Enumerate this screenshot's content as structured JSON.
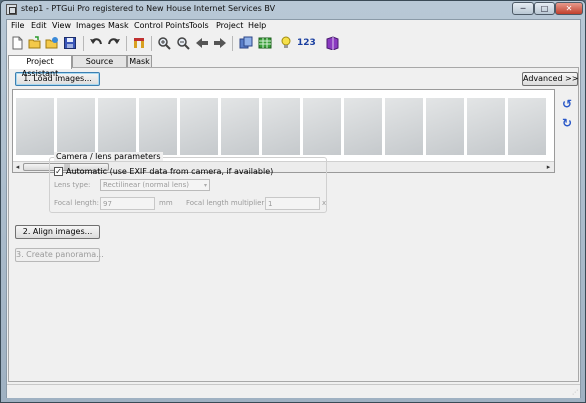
{
  "window": {
    "title": "step1 - PTGui Pro registered to New House Internet Services BV",
    "min_glyph": "─",
    "max_glyph": "□",
    "close_glyph": "✕"
  },
  "menu": [
    "File",
    "Edit",
    "View",
    "Images",
    "Mask",
    "Control Points",
    "Tools",
    "Project",
    "Help"
  ],
  "toolbar": {
    "icons": [
      "new-file-icon",
      "open-folder-icon",
      "open-recent-icon",
      "save-icon",
      "undo-icon",
      "redo-icon",
      "control-point-editor-icon",
      "zoom-in-icon",
      "zoom-out-icon",
      "back-arrow-icon",
      "forward-arrow-icon",
      "panorama-editor-icon",
      "table-icon",
      "lightbulb-icon",
      "optimizer-icon",
      "batch-book-icon"
    ],
    "number_label": "123"
  },
  "tabs": [
    "Project Assistant",
    "Source Images",
    "Mask"
  ],
  "main": {
    "load_button": "1. Load images...",
    "advanced_button": "Advanced >>",
    "thumbnail_count": 13,
    "scroll_left": "◂",
    "scroll_right": "▸",
    "scroll_grip": "|||",
    "rotate_ccw_glyph": "↺",
    "rotate_cw_glyph": "↻",
    "camera_group_title": "Camera / lens parameters",
    "auto_check_mark": "✓",
    "auto_exif_label": "Automatic (use EXIF data from camera, if available)",
    "lens_type_label": "Lens type:",
    "lens_type_value": "Rectilinear (normal lens)",
    "lens_type_arrow": "▾",
    "focal_length_label": "Focal length:",
    "focal_length_value": "97",
    "focal_length_unit": "mm",
    "multiplier_label": "Focal length multiplier:",
    "multiplier_value": "1",
    "multiplier_unit": "x",
    "align_button": "2. Align images...",
    "create_button": "3. Create panorama..."
  },
  "status": {
    "grip": "⋰"
  }
}
